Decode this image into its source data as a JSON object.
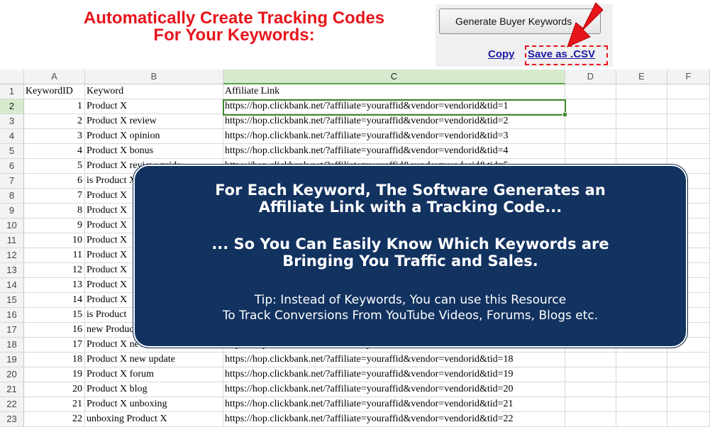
{
  "header": {
    "headline_line1": "Automatically Create Tracking Codes",
    "headline_line2": "For Your Keywords:"
  },
  "tool": {
    "generate_button": "Generate Buyer Keywords",
    "copy_link": "Copy",
    "save_csv_link": "Save as .CSV"
  },
  "sheet": {
    "columns": [
      "A",
      "B",
      "C",
      "D",
      "E",
      "F"
    ],
    "selected_column": "C",
    "active_row": 2,
    "rows": [
      {
        "n": "1",
        "a": "KeywordID",
        "b": "Keyword",
        "c": "Affiliate Link"
      },
      {
        "n": "2",
        "a": "1",
        "b": "Product X",
        "c": "https://hop.clickbank.net/?affiliate=youraffid&vendor=vendorid&tid=1"
      },
      {
        "n": "3",
        "a": "2",
        "b": "Product X review",
        "c": "https://hop.clickbank.net/?affiliate=youraffid&vendor=vendorid&tid=2"
      },
      {
        "n": "4",
        "a": "3",
        "b": "Product X opinion",
        "c": "https://hop.clickbank.net/?affiliate=youraffid&vendor=vendorid&tid=3"
      },
      {
        "n": "5",
        "a": "4",
        "b": "Product X bonus",
        "c": "https://hop.clickbank.net/?affiliate=youraffid&vendor=vendorid&tid=4"
      },
      {
        "n": "6",
        "a": "5",
        "b": "Product X review guide",
        "c": "https://hop.clickbank.net/?affiliate=youraffid&vendor=vendorid&tid=5"
      },
      {
        "n": "7",
        "a": "6",
        "b": "is Product X",
        "c": ""
      },
      {
        "n": "8",
        "a": "7",
        "b": "Product X",
        "c": ""
      },
      {
        "n": "9",
        "a": "8",
        "b": "Product X",
        "c": ""
      },
      {
        "n": "10",
        "a": "9",
        "b": "Product X",
        "c": ""
      },
      {
        "n": "11",
        "a": "10",
        "b": "Product X",
        "c": ""
      },
      {
        "n": "12",
        "a": "11",
        "b": "Product X",
        "c": ""
      },
      {
        "n": "13",
        "a": "12",
        "b": "Product X",
        "c": ""
      },
      {
        "n": "14",
        "a": "13",
        "b": "Product X",
        "c": ""
      },
      {
        "n": "15",
        "a": "14",
        "b": "Product X",
        "c": ""
      },
      {
        "n": "16",
        "a": "15",
        "b": "is Product",
        "c": ""
      },
      {
        "n": "17",
        "a": "16",
        "b": "new Product",
        "c": ""
      },
      {
        "n": "18",
        "a": "17",
        "b": "Product X new release",
        "c": "https://hop.clickbank.net/?affiliate=youraffid&vendor=vendorid&tid=17"
      },
      {
        "n": "19",
        "a": "18",
        "b": "Product X new update",
        "c": "https://hop.clickbank.net/?affiliate=youraffid&vendor=vendorid&tid=18"
      },
      {
        "n": "20",
        "a": "19",
        "b": "Product X forum",
        "c": "https://hop.clickbank.net/?affiliate=youraffid&vendor=vendorid&tid=19"
      },
      {
        "n": "21",
        "a": "20",
        "b": "Product X blog",
        "c": "https://hop.clickbank.net/?affiliate=youraffid&vendor=vendorid&tid=20"
      },
      {
        "n": "22",
        "a": "21",
        "b": "Product X unboxing",
        "c": "https://hop.clickbank.net/?affiliate=youraffid&vendor=vendorid&tid=21"
      },
      {
        "n": "23",
        "a": "22",
        "b": "unboxing Product X",
        "c": "https://hop.clickbank.net/?affiliate=youraffid&vendor=vendorid&tid=22"
      }
    ]
  },
  "callout": {
    "line1": "For Each Keyword, The Software Generates an",
    "line2": "Affiliate Link  with a Tracking Code...",
    "line3": "... So You Can Easily Know Which Keywords are",
    "line4": "Bringing You Traffic and Sales.",
    "tip1": "Tip: Instead of Keywords, You can use this Resource",
    "tip2": "To Track Conversions From YouTube Videos, Forums, Blogs etc."
  },
  "colors": {
    "headline": "#e8141b",
    "link": "#1a1aa6",
    "callout_bg": "#123260",
    "selection": "#3d8a2e"
  }
}
